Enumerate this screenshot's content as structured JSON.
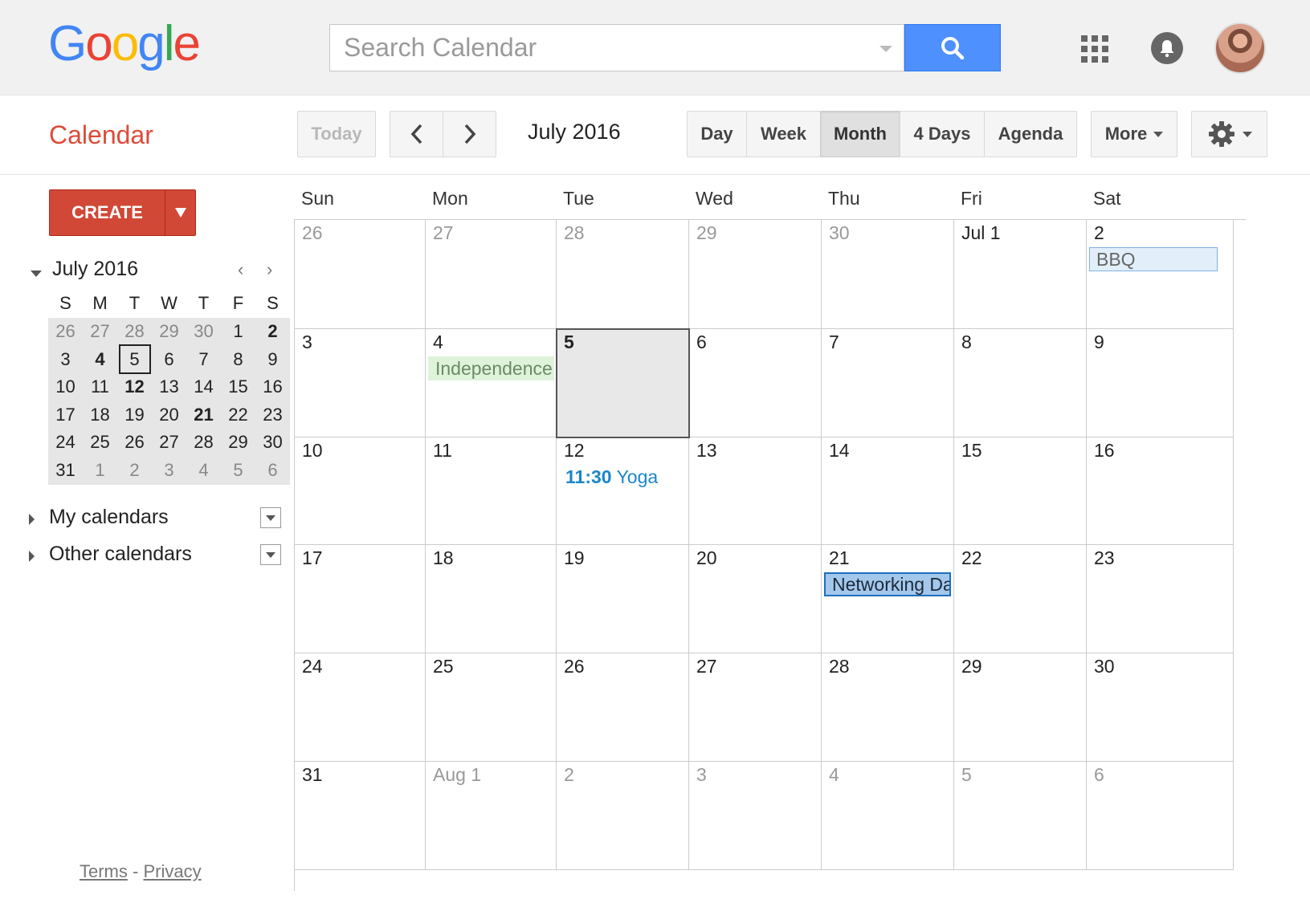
{
  "header": {
    "logo_letters": [
      {
        "ch": "G",
        "color": "#4285f4"
      },
      {
        "ch": "o",
        "color": "#ea4335"
      },
      {
        "ch": "o",
        "color": "#fbbc05"
      },
      {
        "ch": "g",
        "color": "#4285f4"
      },
      {
        "ch": "l",
        "color": "#34a853"
      },
      {
        "ch": "e",
        "color": "#ea4335"
      }
    ],
    "search_placeholder": "Search Calendar",
    "icons": [
      "search-icon",
      "apps-grid-icon",
      "bell-icon",
      "avatar"
    ]
  },
  "toolbar": {
    "app_name": "Calendar",
    "today_label": "Today",
    "current_period": "July 2016",
    "views": {
      "day": "Day",
      "week": "Week",
      "month": "Month",
      "four_days": "4 Days",
      "agenda": "Agenda"
    },
    "active_view": "Month",
    "more_label": "More"
  },
  "sidebar": {
    "create_label": "CREATE",
    "mini_calendar": {
      "title": "July 2016",
      "dow": [
        "S",
        "M",
        "T",
        "W",
        "T",
        "F",
        "S"
      ],
      "weeks": [
        [
          {
            "d": "26",
            "o": true
          },
          {
            "d": "27",
            "o": true
          },
          {
            "d": "28",
            "o": true
          },
          {
            "d": "29",
            "o": true
          },
          {
            "d": "30",
            "o": true
          },
          {
            "d": "1"
          },
          {
            "d": "2",
            "b": true
          }
        ],
        [
          {
            "d": "3"
          },
          {
            "d": "4",
            "b": true
          },
          {
            "d": "5",
            "t": true
          },
          {
            "d": "6"
          },
          {
            "d": "7"
          },
          {
            "d": "8"
          },
          {
            "d": "9"
          }
        ],
        [
          {
            "d": "10"
          },
          {
            "d": "11"
          },
          {
            "d": "12",
            "b": true
          },
          {
            "d": "13"
          },
          {
            "d": "14"
          },
          {
            "d": "15"
          },
          {
            "d": "16"
          }
        ],
        [
          {
            "d": "17"
          },
          {
            "d": "18"
          },
          {
            "d": "19"
          },
          {
            "d": "20"
          },
          {
            "d": "21",
            "b": true
          },
          {
            "d": "22"
          },
          {
            "d": "23"
          }
        ],
        [
          {
            "d": "24"
          },
          {
            "d": "25"
          },
          {
            "d": "26"
          },
          {
            "d": "27"
          },
          {
            "d": "28"
          },
          {
            "d": "29"
          },
          {
            "d": "30"
          }
        ],
        [
          {
            "d": "31"
          },
          {
            "d": "1",
            "o": true
          },
          {
            "d": "2",
            "o": true
          },
          {
            "d": "3",
            "o": true
          },
          {
            "d": "4",
            "o": true
          },
          {
            "d": "5",
            "o": true
          },
          {
            "d": "6",
            "o": true
          }
        ]
      ]
    },
    "my_calendars_label": "My calendars",
    "other_calendars_label": "Other calendars",
    "footer": {
      "terms": "Terms",
      "separator": "-",
      "privacy": "Privacy"
    }
  },
  "month": {
    "dow": [
      "Sun",
      "Mon",
      "Tue",
      "Wed",
      "Thu",
      "Fri",
      "Sat"
    ],
    "weeks": [
      [
        {
          "d": "26",
          "o": true
        },
        {
          "d": "27",
          "o": true
        },
        {
          "d": "28",
          "o": true
        },
        {
          "d": "29",
          "o": true
        },
        {
          "d": "30",
          "o": true
        },
        {
          "d": "Jul 1"
        },
        {
          "d": "2"
        }
      ],
      [
        {
          "d": "3"
        },
        {
          "d": "4"
        },
        {
          "d": "5",
          "t": true
        },
        {
          "d": "6"
        },
        {
          "d": "7"
        },
        {
          "d": "8"
        },
        {
          "d": "9"
        }
      ],
      [
        {
          "d": "10"
        },
        {
          "d": "11"
        },
        {
          "d": "12"
        },
        {
          "d": "13"
        },
        {
          "d": "14"
        },
        {
          "d": "15"
        },
        {
          "d": "16"
        }
      ],
      [
        {
          "d": "17"
        },
        {
          "d": "18"
        },
        {
          "d": "19"
        },
        {
          "d": "20"
        },
        {
          "d": "21"
        },
        {
          "d": "22"
        },
        {
          "d": "23"
        }
      ],
      [
        {
          "d": "24"
        },
        {
          "d": "25"
        },
        {
          "d": "26"
        },
        {
          "d": "27"
        },
        {
          "d": "28"
        },
        {
          "d": "29"
        },
        {
          "d": "30"
        }
      ],
      [
        {
          "d": "31"
        },
        {
          "d": "Aug 1",
          "o": true
        },
        {
          "d": "2",
          "o": true
        },
        {
          "d": "3",
          "o": true
        },
        {
          "d": "4",
          "o": true
        },
        {
          "d": "5",
          "o": true
        },
        {
          "d": "6",
          "o": true
        }
      ]
    ],
    "events": {
      "bbq": {
        "title": "BBQ"
      },
      "independence": {
        "title": "Independence Day"
      },
      "yoga": {
        "time": "11:30",
        "title": "Yoga"
      },
      "networking": {
        "title": "Networking Day"
      }
    }
  },
  "colors": {
    "accent_red": "#dd4b39",
    "create_red": "#d14836",
    "search_blue": "#4d90fe",
    "event_link_blue": "#1a87c8"
  }
}
